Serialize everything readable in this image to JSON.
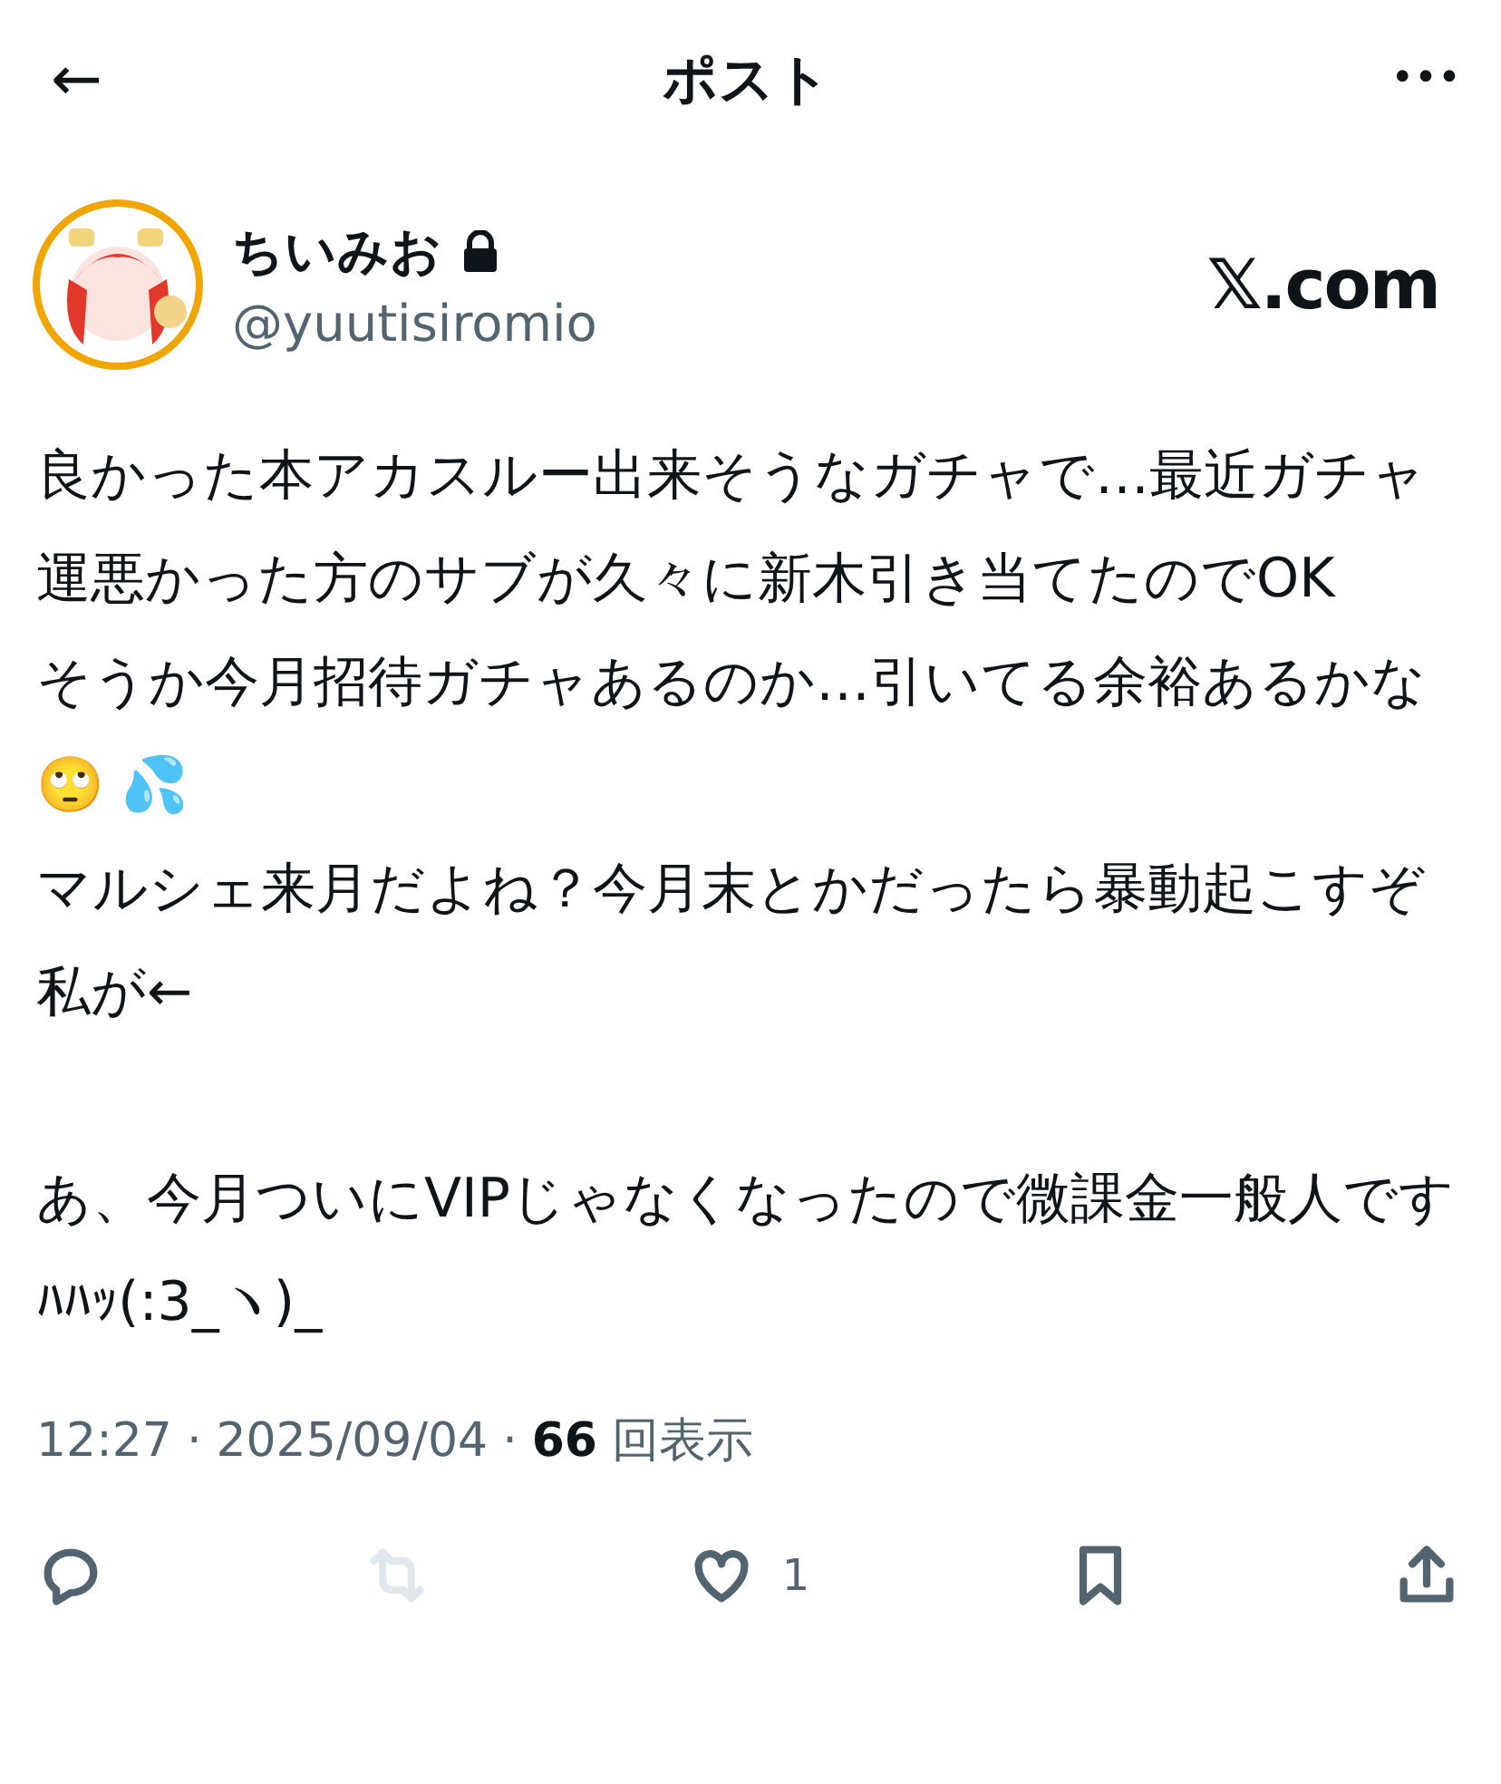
{
  "header": {
    "back": "←",
    "title": "ポスト",
    "more": "•••"
  },
  "author": {
    "name": "ちいみお",
    "protected": true,
    "handle": "@yuutisiromio"
  },
  "brand": "𝕏.com",
  "body": [
    [
      "良かった本アカスルー出来そうなガチャで…最近ガチャ運悪かった方のサブが久々に新木引き当てたのでOK",
      "そうか今月招待ガチャあるのか…引いてる余裕あるかな🙄 💦",
      "マルシェ来月だよね？今月末とかだったら暴動起こすぞ私が←"
    ],
    [
      "あ、今月ついにVIPじゃなくなったので微課金一般人ですﾊﾊｯ(:3_ヽ)_"
    ]
  ],
  "meta": {
    "time": "12:27",
    "separator": "·",
    "date": "2025/09/04",
    "views": "66",
    "views_label": "回表示"
  },
  "actions": [
    {
      "kind": "reply",
      "disabled": false
    },
    {
      "kind": "repost",
      "disabled": true
    },
    {
      "kind": "like",
      "disabled": false,
      "count": "1"
    },
    {
      "kind": "bookmark",
      "disabled": false
    },
    {
      "kind": "share",
      "disabled": false
    }
  ]
}
